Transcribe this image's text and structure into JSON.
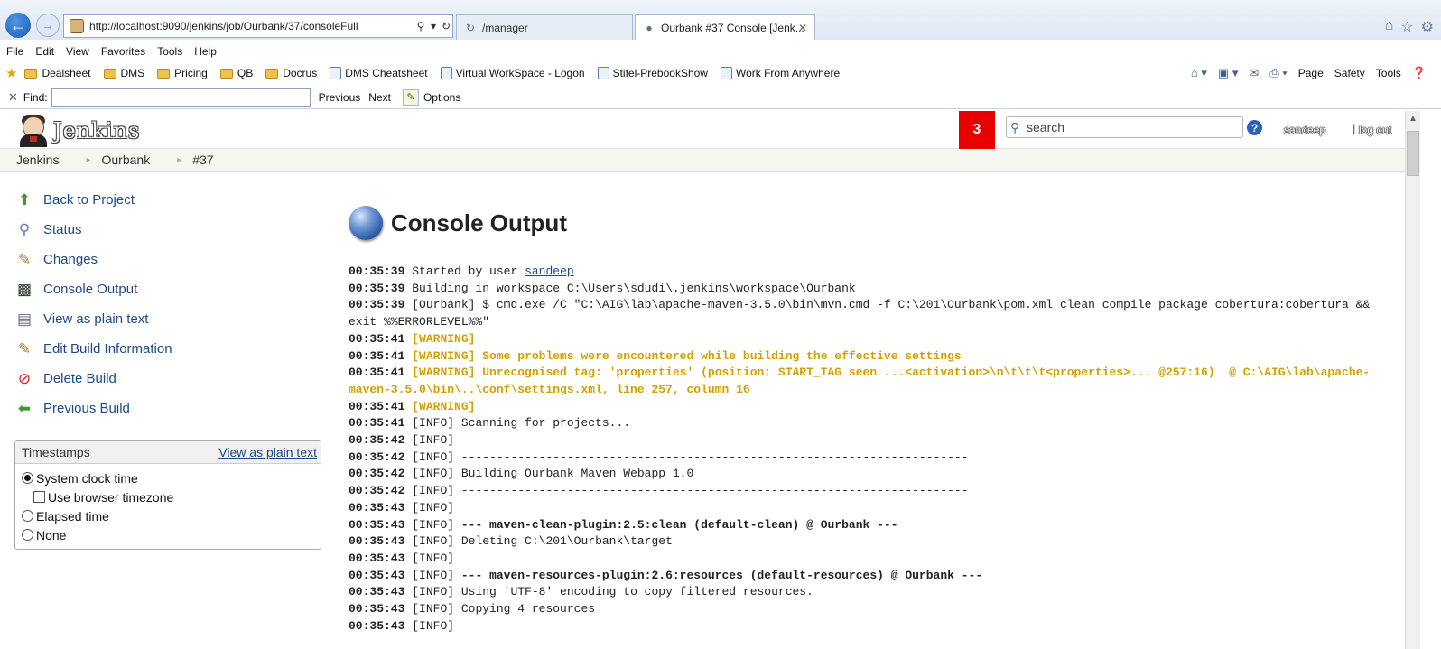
{
  "browser": {
    "address_url": "http://localhost:9090/jenkins/job/Ourbank/37/consoleFull",
    "tabs": [
      {
        "label": "/manager"
      },
      {
        "label": "Ourbank #37 Console [Jenk..."
      }
    ],
    "menu": [
      "File",
      "Edit",
      "View",
      "Favorites",
      "Tools",
      "Help"
    ],
    "favorites": [
      {
        "label": "Dealsheet",
        "type": "folder"
      },
      {
        "label": "DMS",
        "type": "folder"
      },
      {
        "label": "Pricing",
        "type": "folder"
      },
      {
        "label": "QB",
        "type": "folder"
      },
      {
        "label": "Docrus",
        "type": "folder"
      },
      {
        "label": "DMS Cheatsheet",
        "type": "page"
      },
      {
        "label": "Virtual WorkSpace - Logon",
        "type": "page"
      },
      {
        "label": "Stifel-PrebookShow",
        "type": "page"
      },
      {
        "label": "Work From Anywhere",
        "type": "page"
      }
    ],
    "command_bar": {
      "page": "Page",
      "safety": "Safety",
      "tools": "Tools"
    },
    "find": {
      "label": "Find:",
      "value": "",
      "previous": "Previous",
      "next": "Next",
      "options": "Options"
    }
  },
  "jenkins": {
    "logo_text": "Jenkins",
    "notification_count": "3",
    "search_placeholder": "search",
    "help": "?",
    "user": "sandeep",
    "logout": "log out",
    "breadcrumbs": [
      "Jenkins",
      "Ourbank",
      "#37"
    ],
    "tasks": [
      {
        "label": "Back to Project",
        "icon": "up-arrow-icon"
      },
      {
        "label": "Status",
        "icon": "magnifier-icon"
      },
      {
        "label": "Changes",
        "icon": "notepad-icon"
      },
      {
        "label": "Console Output",
        "icon": "terminal-icon"
      },
      {
        "label": "View as plain text",
        "icon": "document-icon"
      },
      {
        "label": "Edit Build Information",
        "icon": "notepad-icon"
      },
      {
        "label": "Delete Build",
        "icon": "no-entry-icon"
      },
      {
        "label": "Previous Build",
        "icon": "left-arrow-icon"
      }
    ],
    "timestamps": {
      "title": "Timestamps",
      "plain_text_link": "View as plain text",
      "options": [
        {
          "label": "System clock time",
          "kind": "radio",
          "checked": true
        },
        {
          "label": "Use browser timezone",
          "kind": "checkbox",
          "checked": false
        },
        {
          "label": "Elapsed time",
          "kind": "radio",
          "checked": false
        },
        {
          "label": "None",
          "kind": "radio",
          "checked": false
        }
      ]
    },
    "page_title": "Console Output",
    "console": [
      {
        "time": "00:35:39",
        "text": "Started by user ",
        "link": "sandeep",
        "style": "normal"
      },
      {
        "time": "00:35:39",
        "text": "Building in workspace C:\\Users\\sdudi\\.jenkins\\workspace\\Ourbank",
        "style": "normal"
      },
      {
        "time": "00:35:39",
        "text": "[Ourbank] $ cmd.exe /C \"C:\\AIG\\lab\\apache-maven-3.5.0\\bin\\mvn.cmd -f C:\\201\\Ourbank\\pom.xml clean compile package cobertura:cobertura && exit %%ERRORLEVEL%%\"",
        "style": "normal"
      },
      {
        "time": "00:35:41",
        "text": "[WARNING]",
        "style": "warn"
      },
      {
        "time": "00:35:41",
        "text": "[WARNING] Some problems were encountered while building the effective settings",
        "style": "warn"
      },
      {
        "time": "00:35:41",
        "text": "[WARNING] Unrecognised tag: 'properties' (position: START_TAG seen ...<activation>\\n\\t\\t\\t<properties>... @257:16)  @ C:\\AIG\\lab\\apache-maven-3.5.0\\bin\\..\\conf\\settings.xml, line 257, column 16",
        "style": "warn"
      },
      {
        "time": "00:35:41",
        "text": "[WARNING]",
        "style": "warn"
      },
      {
        "time": "00:35:41",
        "text": "[INFO] Scanning for projects...",
        "style": "normal"
      },
      {
        "time": "00:35:42",
        "text": "[INFO]",
        "style": "normal"
      },
      {
        "time": "00:35:42",
        "text": "[INFO] ------------------------------------------------------------------------",
        "style": "normal"
      },
      {
        "time": "00:35:42",
        "text": "[INFO] Building Ourbank Maven Webapp 1.0",
        "style": "normal"
      },
      {
        "time": "00:35:42",
        "text": "[INFO] ------------------------------------------------------------------------",
        "style": "normal"
      },
      {
        "time": "00:35:43",
        "text": "[INFO]",
        "style": "normal"
      },
      {
        "time": "00:35:43",
        "text": "[INFO] ",
        "bold": "--- maven-clean-plugin:2.5:clean (default-clean) @ Ourbank ---",
        "style": "normal"
      },
      {
        "time": "00:35:43",
        "text": "[INFO] Deleting C:\\201\\Ourbank\\target",
        "style": "normal"
      },
      {
        "time": "00:35:43",
        "text": "[INFO]",
        "style": "normal"
      },
      {
        "time": "00:35:43",
        "text": "[INFO] ",
        "bold": "--- maven-resources-plugin:2.6:resources (default-resources) @ Ourbank ---",
        "style": "normal"
      },
      {
        "time": "00:35:43",
        "text": "[INFO] Using 'UTF-8' encoding to copy filtered resources.",
        "style": "normal"
      },
      {
        "time": "00:35:43",
        "text": "[INFO] Copying 4 resources",
        "style": "normal"
      },
      {
        "time": "00:35:43",
        "text": "[INFO]",
        "style": "normal"
      }
    ]
  },
  "colors": {
    "warning": "#d4a000",
    "link": "#204a87",
    "badge": "#e80000"
  }
}
